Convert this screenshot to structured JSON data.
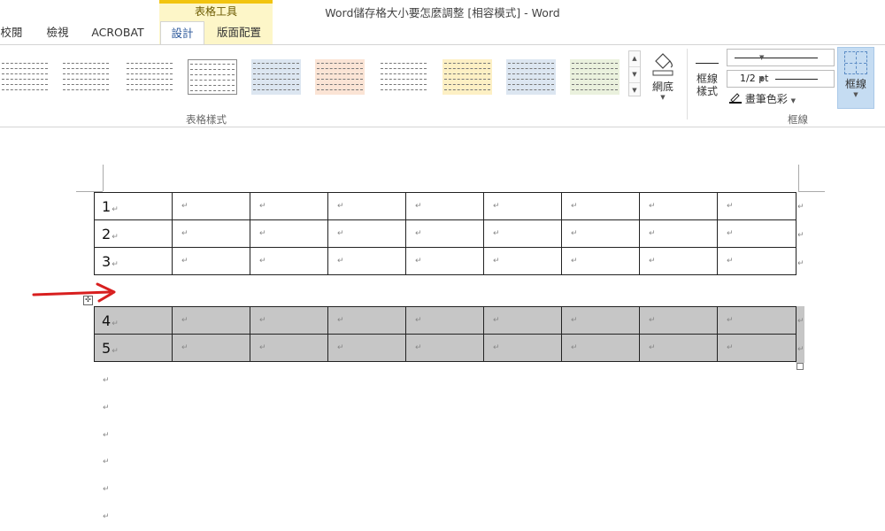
{
  "window": {
    "title": "Word儲存格大小要怎麼調整 [相容模式] - Word"
  },
  "tabs": {
    "contextual_group": "表格工具",
    "items": [
      {
        "label": "校閱"
      },
      {
        "label": "檢視"
      },
      {
        "label": "ACROBAT"
      },
      {
        "label": "設計",
        "active": true
      },
      {
        "label": "版面配置"
      }
    ]
  },
  "ribbon": {
    "table_styles_label": "表格樣式",
    "shading_label": "網底",
    "border_styles_label": "框線\n樣式",
    "line_weight": "1/2 pt",
    "pen_color_label": "畫筆色彩",
    "borders_label": "框線",
    "borders_group_label": "框線",
    "icons": {
      "gallery_up": "chevron-up-icon",
      "gallery_down": "chevron-down-icon",
      "gallery_more": "more-icon",
      "shading": "paint-bucket-icon",
      "pen": "pen-icon",
      "borders": "borders-grid-icon"
    },
    "colors": {
      "accent": "#2b579a",
      "context_tab": "#f2c40f",
      "selected_button": "#c5dcf2"
    }
  },
  "document": {
    "paragraph_mark": "↵",
    "table_top_rows": [
      "1",
      "2",
      "3"
    ],
    "table_bottom_rows": [
      "4",
      "5"
    ],
    "columns": 9,
    "selection_color": "#c6c6c6",
    "annotation_arrow_color": "#d81f1f"
  }
}
